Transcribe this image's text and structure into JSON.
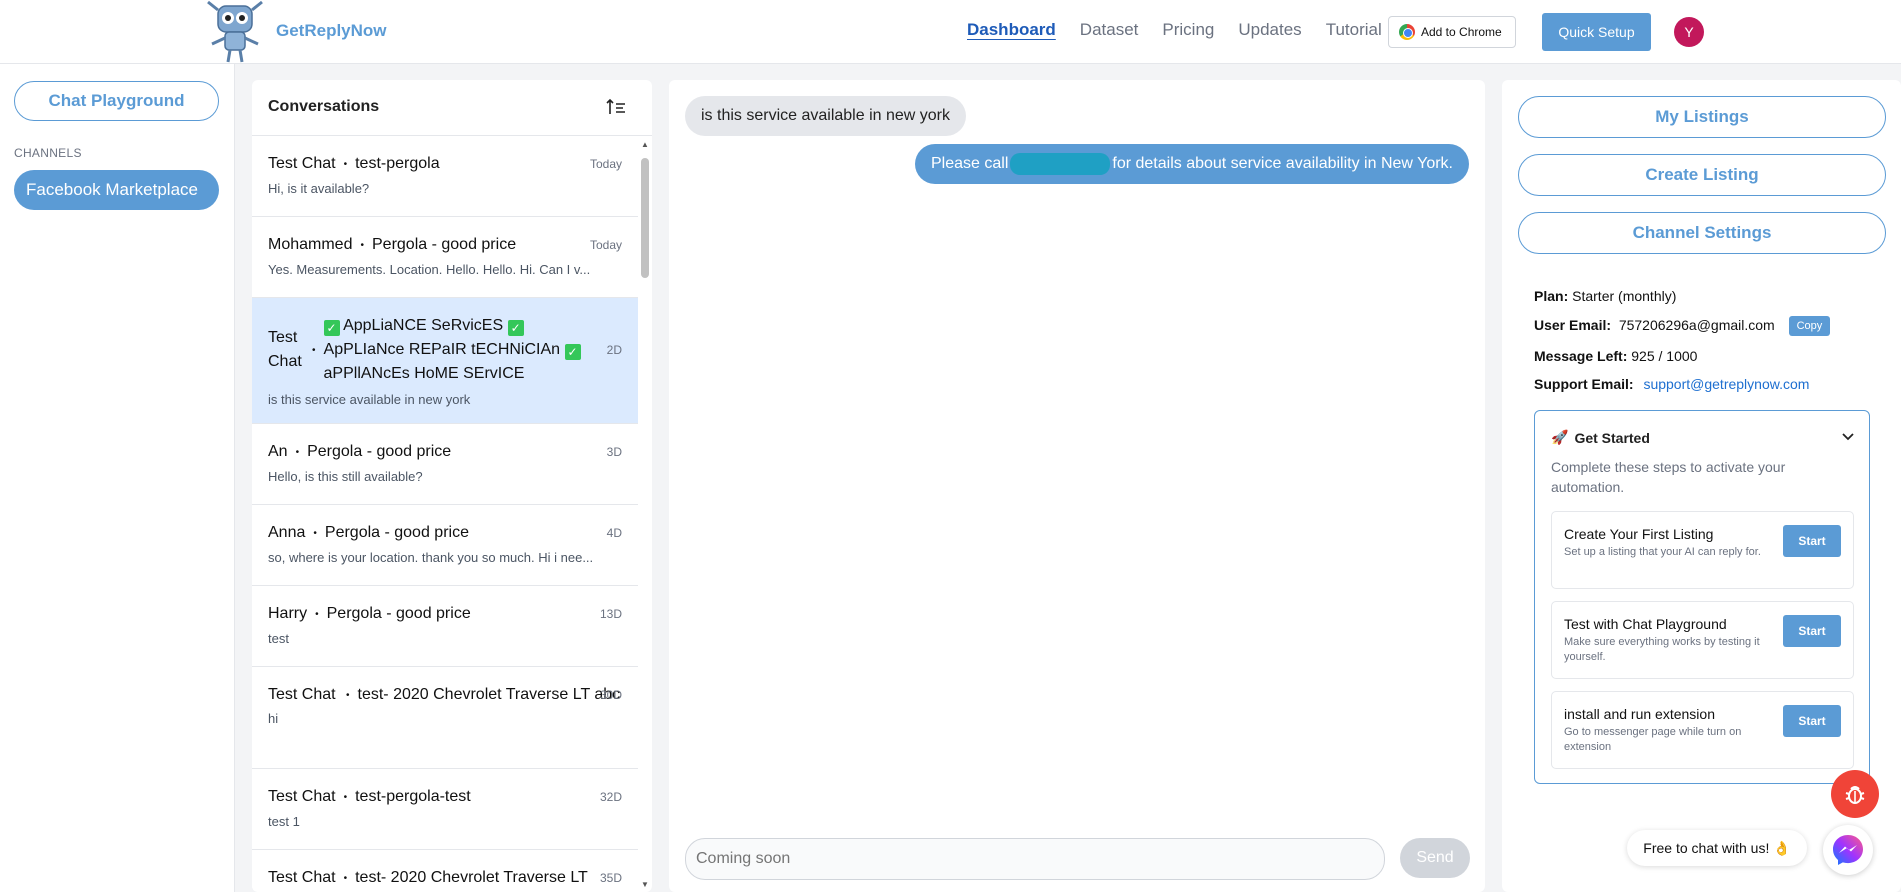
{
  "header": {
    "brand": "GetReplyNow",
    "nav": [
      {
        "label": "Dashboard",
        "active": true
      },
      {
        "label": "Dataset"
      },
      {
        "label": "Pricing"
      },
      {
        "label": "Updates"
      },
      {
        "label": "Tutorial"
      }
    ],
    "add_to_chrome": "Add to Chrome",
    "quick_setup": "Quick Setup",
    "avatar_initial": "Y"
  },
  "sidebar": {
    "chat_playground": "Chat Playground",
    "channels_label": "CHANNELS",
    "channel": "Facebook Marketplace"
  },
  "conversations": {
    "title": "Conversations",
    "items": [
      {
        "name": "Test Chat",
        "listing": "test-pergola",
        "time": "Today",
        "message": "Hi, is it available?"
      },
      {
        "name": "Mohammed",
        "listing": "Pergola - good price",
        "time": "Today",
        "message": "Yes. Measurements. Location. Hello. Hello. Hi. Can I v..."
      },
      {
        "name": "Test Chat",
        "listing_lines": [
          "AppLiaNCE SeRvicES",
          "ApPLIaNce REPaIR tECHNiCIAn",
          "aPPllANcEs HoME SErvICE"
        ],
        "time": "2D",
        "message": "is this service available in new york"
      },
      {
        "name": "An",
        "listing": "Pergola - good price",
        "time": "3D",
        "message": "Hello, is this still available?"
      },
      {
        "name": "Anna",
        "listing": "Pergola - good price",
        "time": "4D",
        "message": "so, where is your location. thank you so much. Hi i nee..."
      },
      {
        "name": "Harry",
        "listing": "Pergola - good price",
        "time": "13D",
        "message": "test"
      },
      {
        "name": "Test Chat",
        "listing": "test- 2020 Chevrolet Traverse LT abc",
        "time": "30D",
        "message": "hi"
      },
      {
        "name": "Test Chat",
        "listing": "test-pergola-test",
        "time": "32D",
        "message": "test 1"
      },
      {
        "name": "Test Chat",
        "listing": "test- 2020 Chevrolet Traverse LT",
        "time": "35D",
        "message": ""
      }
    ]
  },
  "chat": {
    "incoming": "is this service available in new york",
    "outgoing_before": "Please call",
    "outgoing_after": "for details about service availability in New York.",
    "input_placeholder": "Coming soon",
    "send": "Send"
  },
  "right_panel": {
    "my_listings": "My Listings",
    "create_listing": "Create Listing",
    "channel_settings": "Channel Settings",
    "plan_label": "Plan:",
    "plan_value": "Starter (monthly)",
    "email_label": "User Email:",
    "email_value": "757206296a@gmail.com",
    "copy": "Copy",
    "messages_label": "Message Left:",
    "messages_value": "925 / 1000",
    "support_label": "Support Email:",
    "support_value": "support@getreplynow.com",
    "get_started": {
      "title": "Get Started",
      "description": "Complete these steps to activate your automation.",
      "steps": [
        {
          "title": "Create Your First Listing",
          "desc": "Set up a listing that your AI can reply for.",
          "button": "Start"
        },
        {
          "title": "Test with Chat Playground",
          "desc": "Make sure everything works by testing it yourself.",
          "button": "Start"
        },
        {
          "title": "install and run extension",
          "desc": "Go to messenger page while turn on extension",
          "button": "Start"
        }
      ]
    }
  },
  "widgets": {
    "chat_prompt": "Free to chat with us! 👌"
  },
  "colors": {
    "accent": "#5b9bd5",
    "nav_active": "#1e5bb8",
    "avatar": "#c2185b",
    "bug": "#f04438",
    "selected_row": "#dbeafe"
  }
}
